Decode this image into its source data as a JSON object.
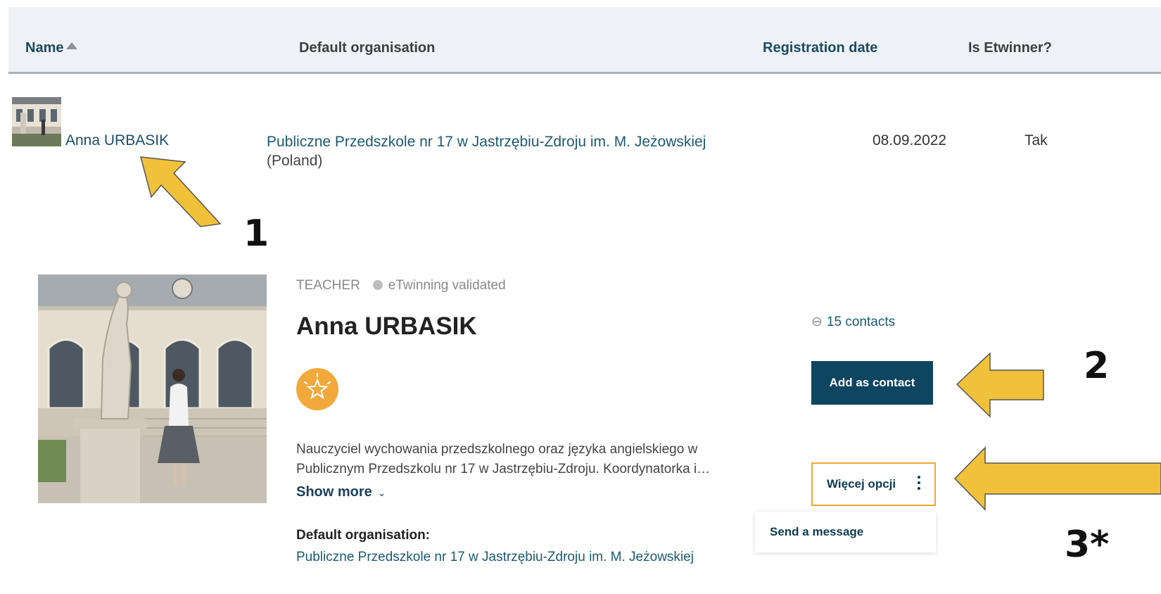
{
  "table": {
    "headers": {
      "name": "Name",
      "default_org": "Default organisation",
      "registration_date": "Registration date",
      "is_etwinner": "Is Etwinner?"
    },
    "row": {
      "name": "Anna URBASIK",
      "org": "Publiczne Przedszkole nr 17 w Jastrzębiu-Zdroju im. M. Jeżowskiej",
      "country": "(Poland)",
      "date": "08.09.2022",
      "etwinner": "Tak"
    }
  },
  "annotations": {
    "numbers": [
      "1",
      "2",
      "3*"
    ],
    "arrow_color": "#f2c13a"
  },
  "profile": {
    "role": "TEACHER",
    "status": "eTwinning validated",
    "name": "Anna URBASIK",
    "badge_icon": "star-icon",
    "bio_line1": "Nauczyciel wychowania przedszkolnego oraz języka angielskiego w",
    "bio_line2": "Publicznym Przedszkolu nr 17 w Jastrzębiu-Zdroju. Koordynatorka i…",
    "show_more": "Show more",
    "default_org_label": "Default organisation:",
    "default_org_value": "Publiczne Przedszkole nr 17 w Jastrzębiu-Zdroju im. M. Jeżowskiej",
    "contacts": "15 contacts",
    "add_contact": "Add as contact",
    "more_options": "Więcej opcji",
    "dropdown_item": "Send a message"
  },
  "colors": {
    "accent_dark": "#0e4560",
    "link": "#1b5a70",
    "highlight_border": "#f0a431",
    "badge": "#f2a93b"
  }
}
